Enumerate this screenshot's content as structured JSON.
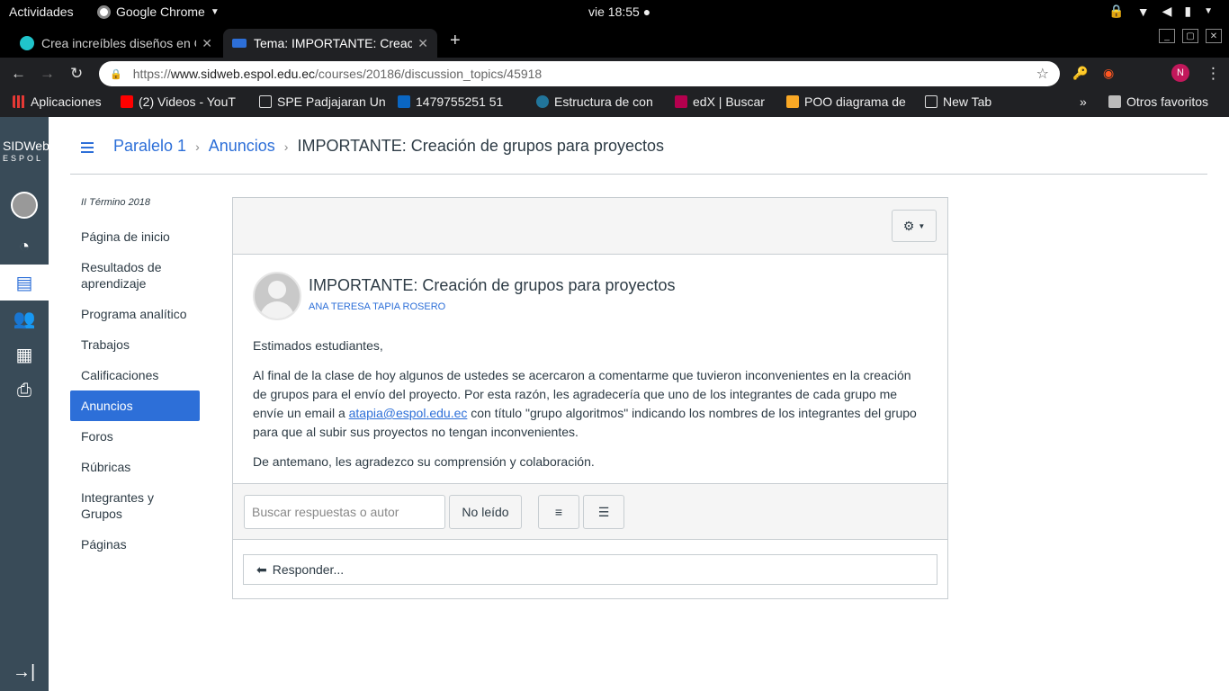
{
  "system": {
    "activities": "Actividades",
    "app_name": "Google Chrome",
    "clock": "vie 18:55"
  },
  "tabs": [
    {
      "title": "Crea increíbles diseños en C"
    },
    {
      "title": "Tema: IMPORTANTE: Creac"
    }
  ],
  "address": {
    "scheme": "https://",
    "host": "www.sidweb.espol.edu.ec",
    "path": "/courses/20186/discussion_topics/45918"
  },
  "profile_initial": "N",
  "bookmarks": [
    {
      "label": "Aplicaciones",
      "color": "#e53935"
    },
    {
      "label": "(2) Videos - YouT",
      "color": "#ff0000"
    },
    {
      "label": "SPE Padjajaran Un",
      "color": "#ffffff"
    },
    {
      "label": "1479755251 51",
      "color": "#0a66c2"
    },
    {
      "label": "Estructura de con",
      "color": "#21759b"
    },
    {
      "label": "edX | Buscar",
      "color": "#b4004e"
    },
    {
      "label": "POO diagrama de",
      "color": "#f9a825"
    },
    {
      "label": "New Tab",
      "color": "#ffffff"
    }
  ],
  "other_bookmarks": "Otros favoritos",
  "brand": {
    "line1": "SIDWeb",
    "line2": "ESPOL"
  },
  "breadcrumb": {
    "course": "Paralelo 1",
    "section": "Anuncios",
    "current": "IMPORTANTE: Creación de grupos para proyectos"
  },
  "term": "II Término 2018",
  "course_nav": [
    {
      "label": "Página de inicio",
      "active": false
    },
    {
      "label": "Resultados de aprendizaje",
      "active": false
    },
    {
      "label": "Programa analítico",
      "active": false
    },
    {
      "label": "Trabajos",
      "active": false
    },
    {
      "label": "Calificaciones",
      "active": false
    },
    {
      "label": "Anuncios",
      "active": true
    },
    {
      "label": "Foros",
      "active": false
    },
    {
      "label": "Rúbricas",
      "active": false
    },
    {
      "label": "Integrantes y Grupos",
      "active": false
    },
    {
      "label": "Páginas",
      "active": false
    }
  ],
  "post": {
    "title": "IMPORTANTE: Creación de grupos para proyectos",
    "author": "ANA TERESA TAPIA ROSERO",
    "greeting": "Estimados estudiantes,",
    "body_part1": "Al final de la clase de hoy algunos de ustedes se acercaron a comentarme que tuvieron inconvenientes en la creación de grupos para el envío del proyecto.  Por esta razón, les agradecería que uno de los integrantes de cada grupo me envíe un email a ",
    "email": "atapia@espol.edu.ec",
    "body_part2": " con título \"grupo algoritmos\" indicando los nombres de los integrantes del grupo para que al subir sus proyectos no tengan inconvenientes.",
    "closing": "De antemano, les agradezco su comprensión y colaboración."
  },
  "controls": {
    "search_placeholder": "Buscar respuestas o autor",
    "unread_label": "No leído",
    "reply_label": "Responder..."
  },
  "colors": {
    "accent": "#2d6fd8",
    "global_nav": "#394b58"
  }
}
